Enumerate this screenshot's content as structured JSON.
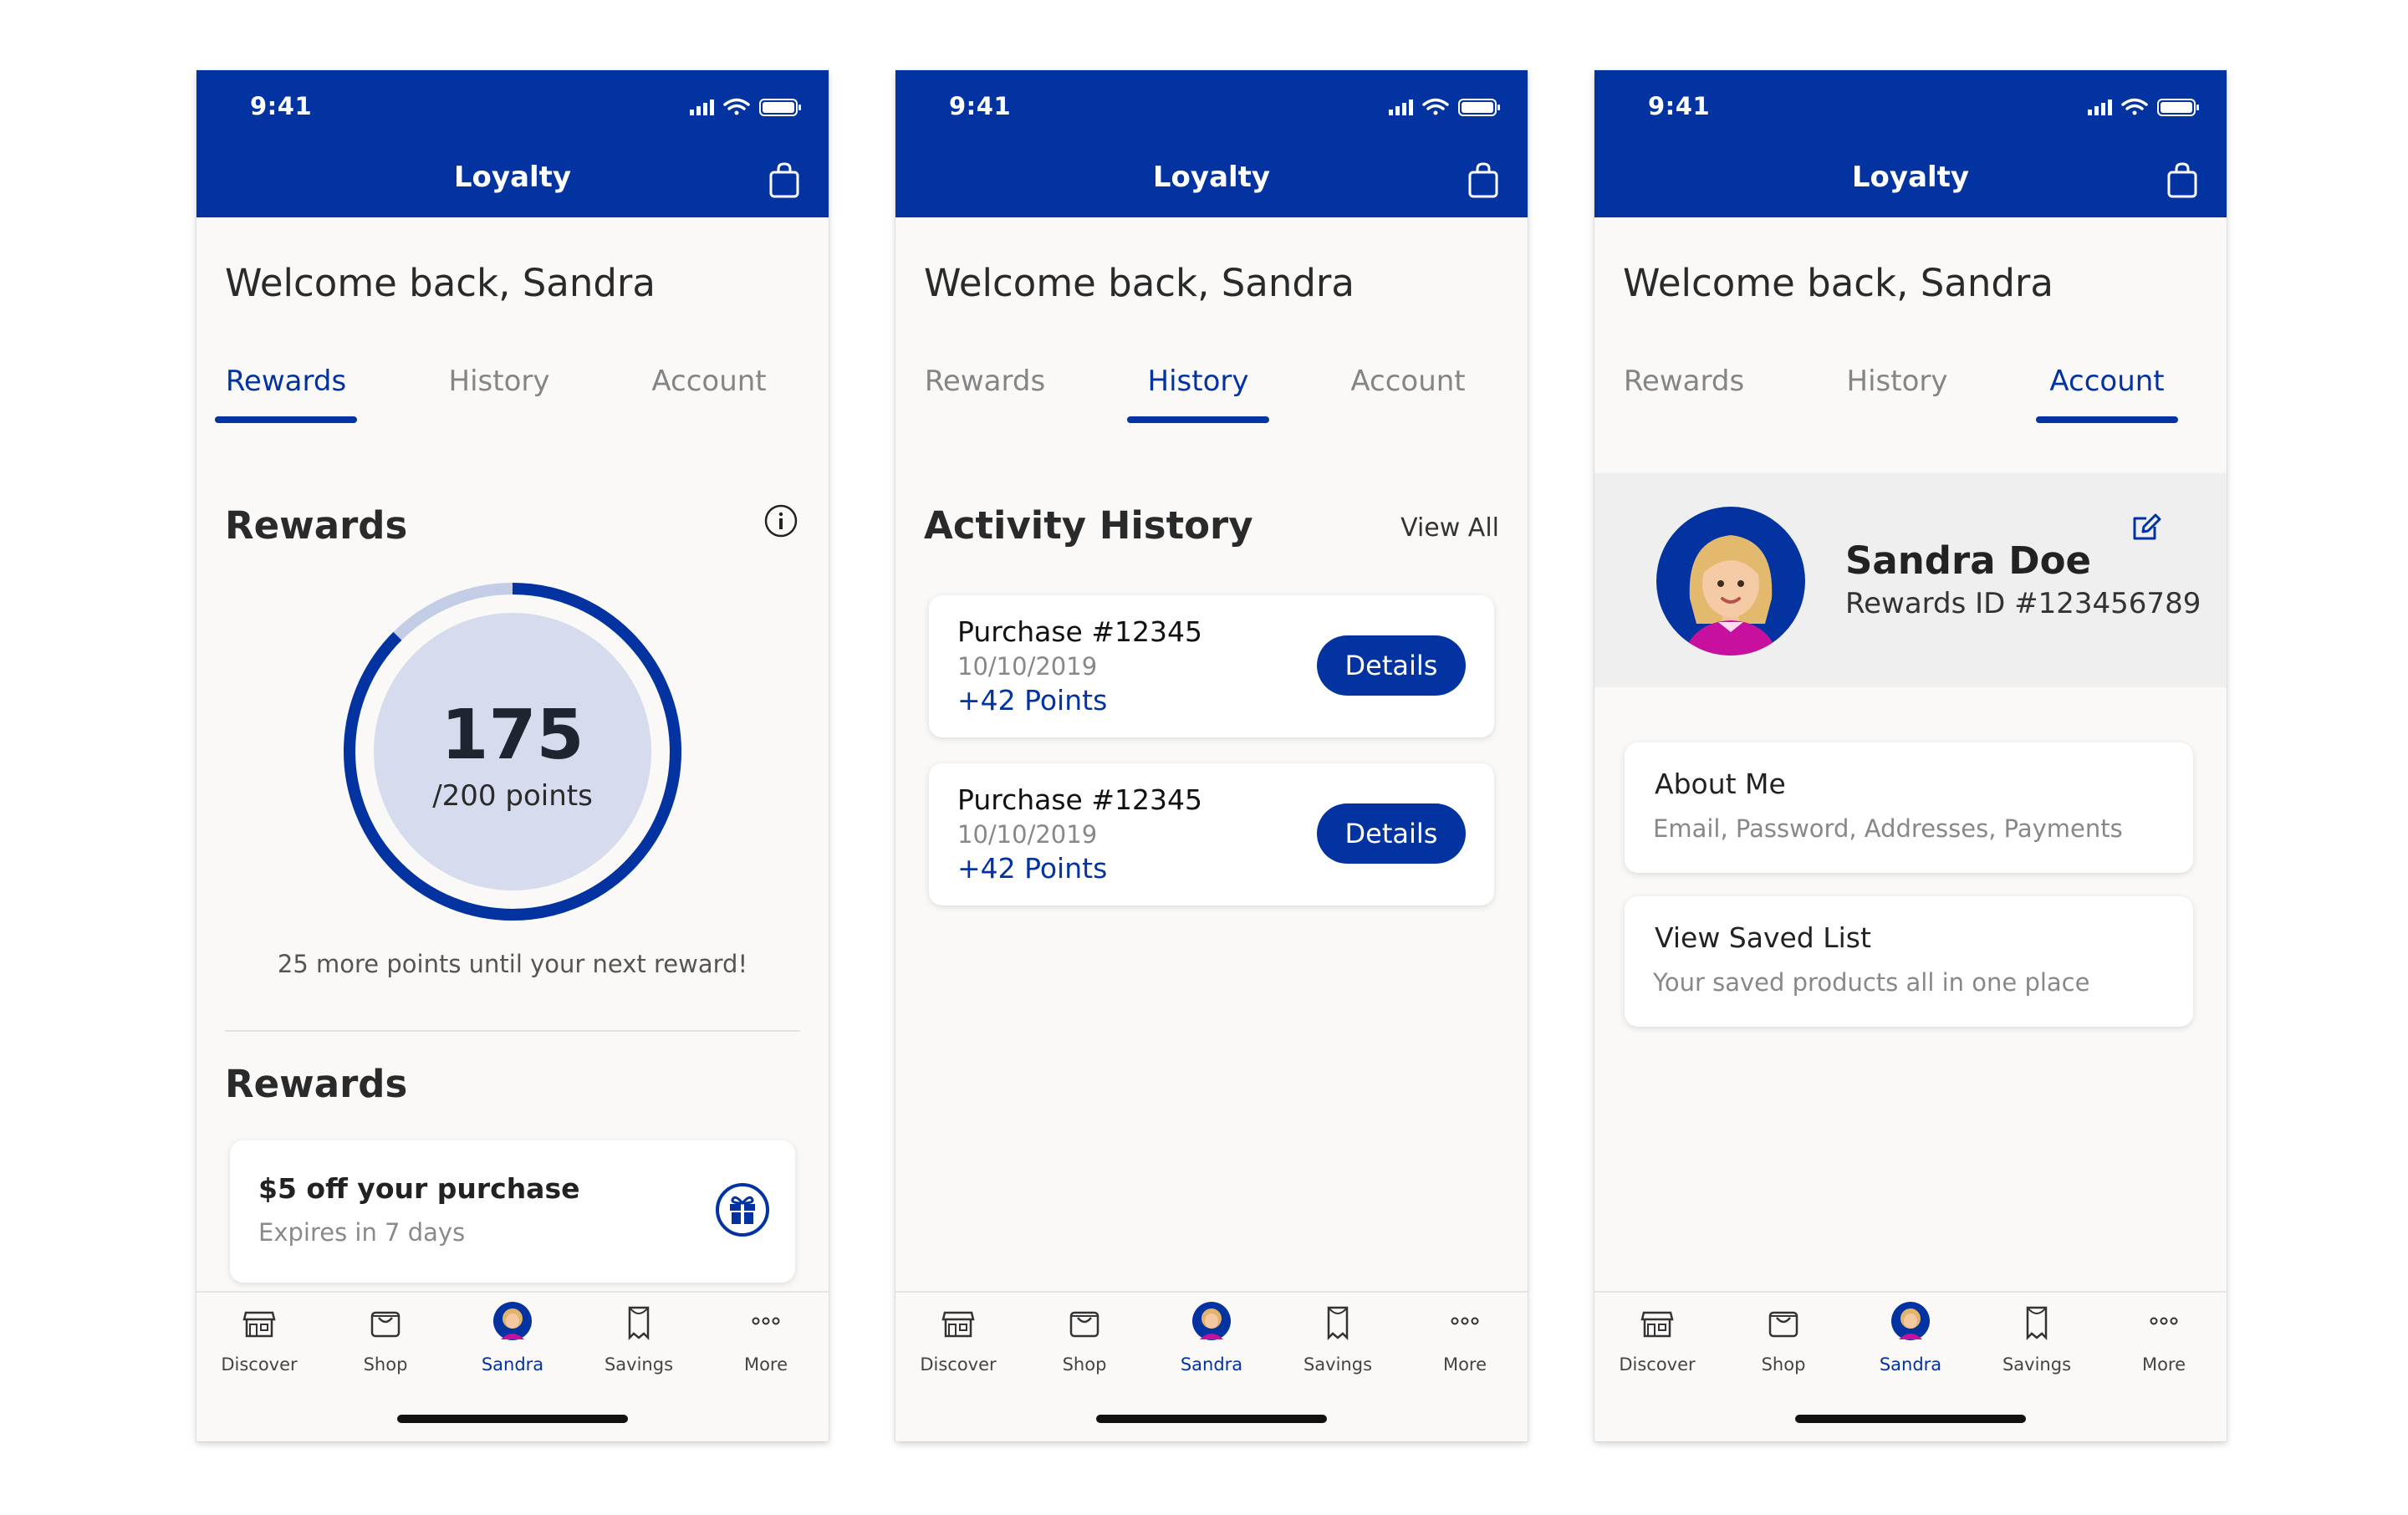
{
  "brand": {
    "primary": "#0333a0",
    "background": "#faf9f7",
    "accent_avatar_shirt": "#c8109e"
  },
  "status_bar": {
    "time": "9:41",
    "icons": [
      "signal-icon",
      "wifi-icon",
      "battery-icon"
    ]
  },
  "header": {
    "title": "Loyalty",
    "bag_icon": "shopping-bag-icon"
  },
  "welcome": "Welcome back, Sandra",
  "tabs": [
    "Rewards",
    "History",
    "Account"
  ],
  "screens": [
    {
      "active_tab": "Rewards",
      "rewards": {
        "title": "Rewards",
        "info_icon": "info-icon",
        "points_value": "175",
        "points_unit": "/200 points",
        "progress_fraction": 0.875,
        "caption": "25 more points until your next reward!",
        "list_title": "Rewards",
        "offer": {
          "title": "$5 off your purchase",
          "subtitle": "Expires in 7 days",
          "icon": "gift-icon"
        }
      }
    },
    {
      "active_tab": "History",
      "history": {
        "title": "Activity History",
        "view_all": "View All",
        "items": [
          {
            "title": "Purchase #12345",
            "date": "10/10/2019",
            "points": "+42 Points",
            "button": "Details"
          },
          {
            "title": "Purchase #12345",
            "date": "10/10/2019",
            "points": "+42 Points",
            "button": "Details"
          }
        ]
      }
    },
    {
      "active_tab": "Account",
      "account": {
        "name": "Sandra Doe",
        "rewards_id": "Rewards ID #123456789",
        "edit_icon": "edit-icon",
        "cards": [
          {
            "title": "About Me",
            "subtitle": "Email, Password, Addresses, Payments"
          },
          {
            "title": "View Saved List",
            "subtitle": "Your saved products all in one place"
          }
        ]
      }
    }
  ],
  "bottom_nav": [
    {
      "label": "Discover",
      "icon": "store-icon"
    },
    {
      "label": "Shop",
      "icon": "shopping-bag-icon"
    },
    {
      "label": "Sandra",
      "icon": "avatar-icon",
      "active": true
    },
    {
      "label": "Savings",
      "icon": "coupon-icon"
    },
    {
      "label": "More",
      "icon": "more-dots-icon"
    }
  ]
}
